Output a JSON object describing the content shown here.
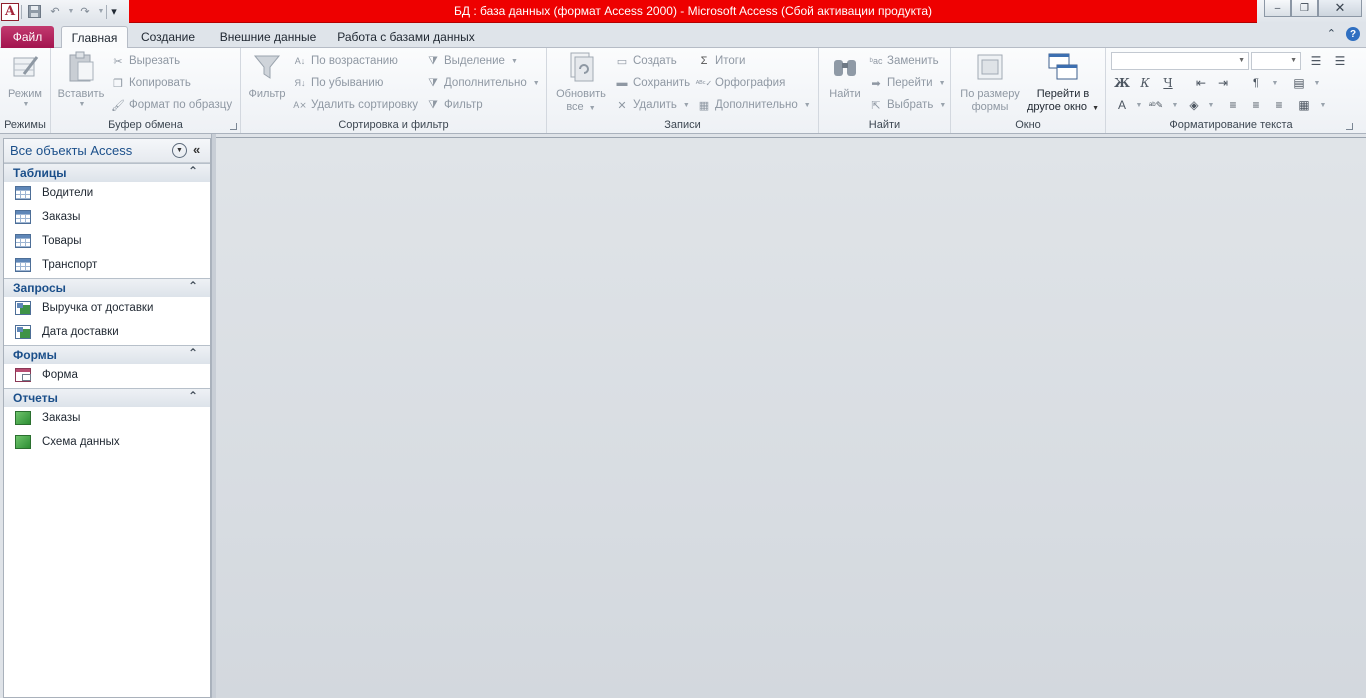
{
  "window": {
    "title": "БД : база данных (формат Access 2000)  -  Microsoft Access (Сбой активации продукта)",
    "app_icon": "A",
    "controls": {
      "minimize": "–",
      "restore": "❐",
      "close": "✕"
    }
  },
  "qat": {
    "save": "💾",
    "undo": "↶",
    "redo": "↷",
    "customize": "▾"
  },
  "tabs": {
    "file": "Файл",
    "items": [
      "Главная",
      "Создание",
      "Внешние данные",
      "Работа с базами данных"
    ]
  },
  "ribbon": {
    "groups": {
      "views": {
        "label": "Режимы",
        "view_btn": "Режим"
      },
      "clipboard": {
        "label": "Буфер обмена",
        "paste": "Вставить",
        "cut": "Вырезать",
        "copy": "Копировать",
        "format_painter": "Формат по образцу"
      },
      "sort_filter": {
        "label": "Сортировка и фильтр",
        "filter_big": "Фильтр",
        "ascending": "По возрастанию",
        "descending": "По убыванию",
        "remove_sort": "Удалить сортировку",
        "selection": "Выделение",
        "advanced": "Дополнительно",
        "toggle_filter": "Фильтр"
      },
      "records": {
        "label": "Записи",
        "refresh_line1": "Обновить",
        "refresh_line2": "все",
        "new": "Создать",
        "save": "Сохранить",
        "delete": "Удалить",
        "totals": "Итоги",
        "spelling": "Орфография",
        "more": "Дополнительно"
      },
      "find": {
        "label": "Найти",
        "find": "Найти",
        "replace": "Заменить",
        "goto": "Перейти",
        "select": "Выбрать"
      },
      "window": {
        "label": "Окно",
        "size_line1": "По размеру",
        "size_line2": "формы",
        "switch_line1": "Перейти в",
        "switch_line2": "другое окно"
      },
      "text_format": {
        "label": "Форматирование текста",
        "bold": "Ж",
        "italic": "К",
        "underline": "Ч"
      }
    }
  },
  "nav": {
    "title": "Все объекты Access",
    "sections": [
      {
        "name": "Таблицы",
        "type": "table",
        "items": [
          "Водители",
          "Заказы",
          "Товары",
          "Транспорт"
        ]
      },
      {
        "name": "Запросы",
        "type": "query",
        "items": [
          "Выручка от доставки",
          "Дата доставки"
        ]
      },
      {
        "name": "Формы",
        "type": "form",
        "items": [
          "Форма"
        ]
      },
      {
        "name": "Отчеты",
        "type": "report",
        "items": [
          "Заказы",
          "Схема данных"
        ]
      }
    ]
  }
}
